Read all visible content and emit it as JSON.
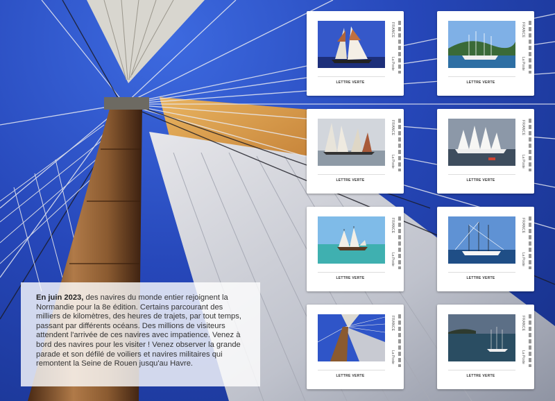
{
  "sheet": {
    "text_box": {
      "lead": "En juin 2023,",
      "body": " des navires du monde entier rejoignent la Normandie pour la 8e édition. Certains parcourant des milliers de kilomètres, des heures de trajets, par tout temps, passant par différents océans. Des millions de visiteurs attendent l'arrivée de ces navires avec impatience. Venez à bord des navires pour les visiter ! Venez observer la grande parade et son défilé de voiliers et navires militaires qui remontent la Seine de Rouen jusqu'au Havre."
    },
    "stamps": [
      {
        "country": "FRANCE",
        "post": "La Poste",
        "value": "LETTRE VERTE",
        "scene": "two-masts-white-sails-sunset"
      },
      {
        "country": "FRANCE",
        "post": "La Poste",
        "value": "LETTRE VERTE",
        "scene": "tall-ship-harbour-hills"
      },
      {
        "country": "FRANCE",
        "post": "La Poste",
        "value": "LETTRE VERTE",
        "scene": "schooners-racing-grey-sea"
      },
      {
        "country": "FRANCE",
        "post": "La Poste",
        "value": "LETTRE VERTE",
        "scene": "full-rigger-white-sails"
      },
      {
        "country": "FRANCE",
        "post": "La Poste",
        "value": "LETTRE VERTE",
        "scene": "brig-turquoise-sea"
      },
      {
        "country": "FRANCE",
        "post": "La Poste",
        "value": "LETTRE VERTE",
        "scene": "barque-blue-sky"
      },
      {
        "country": "FRANCE",
        "post": "La Poste",
        "value": "LETTRE VERTE",
        "scene": "mast-and-rigging"
      },
      {
        "country": "FRANCE",
        "post": "La Poste",
        "value": "LETTRE VERTE",
        "scene": "tall-ship-bay-dusk"
      }
    ]
  }
}
